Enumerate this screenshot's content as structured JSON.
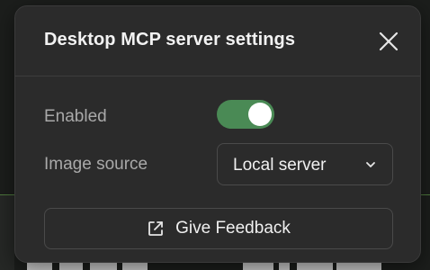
{
  "dialog": {
    "title": "Desktop MCP server settings",
    "close_icon": "close-icon"
  },
  "settings": {
    "enabled": {
      "label": "Enabled",
      "value": true,
      "accent": "#4a8a55"
    },
    "image_source": {
      "label": "Image source",
      "selected": "Local server",
      "icon": "chevron-down-icon"
    }
  },
  "feedback": {
    "label": "Give Feedback",
    "icon": "external-link-icon"
  }
}
